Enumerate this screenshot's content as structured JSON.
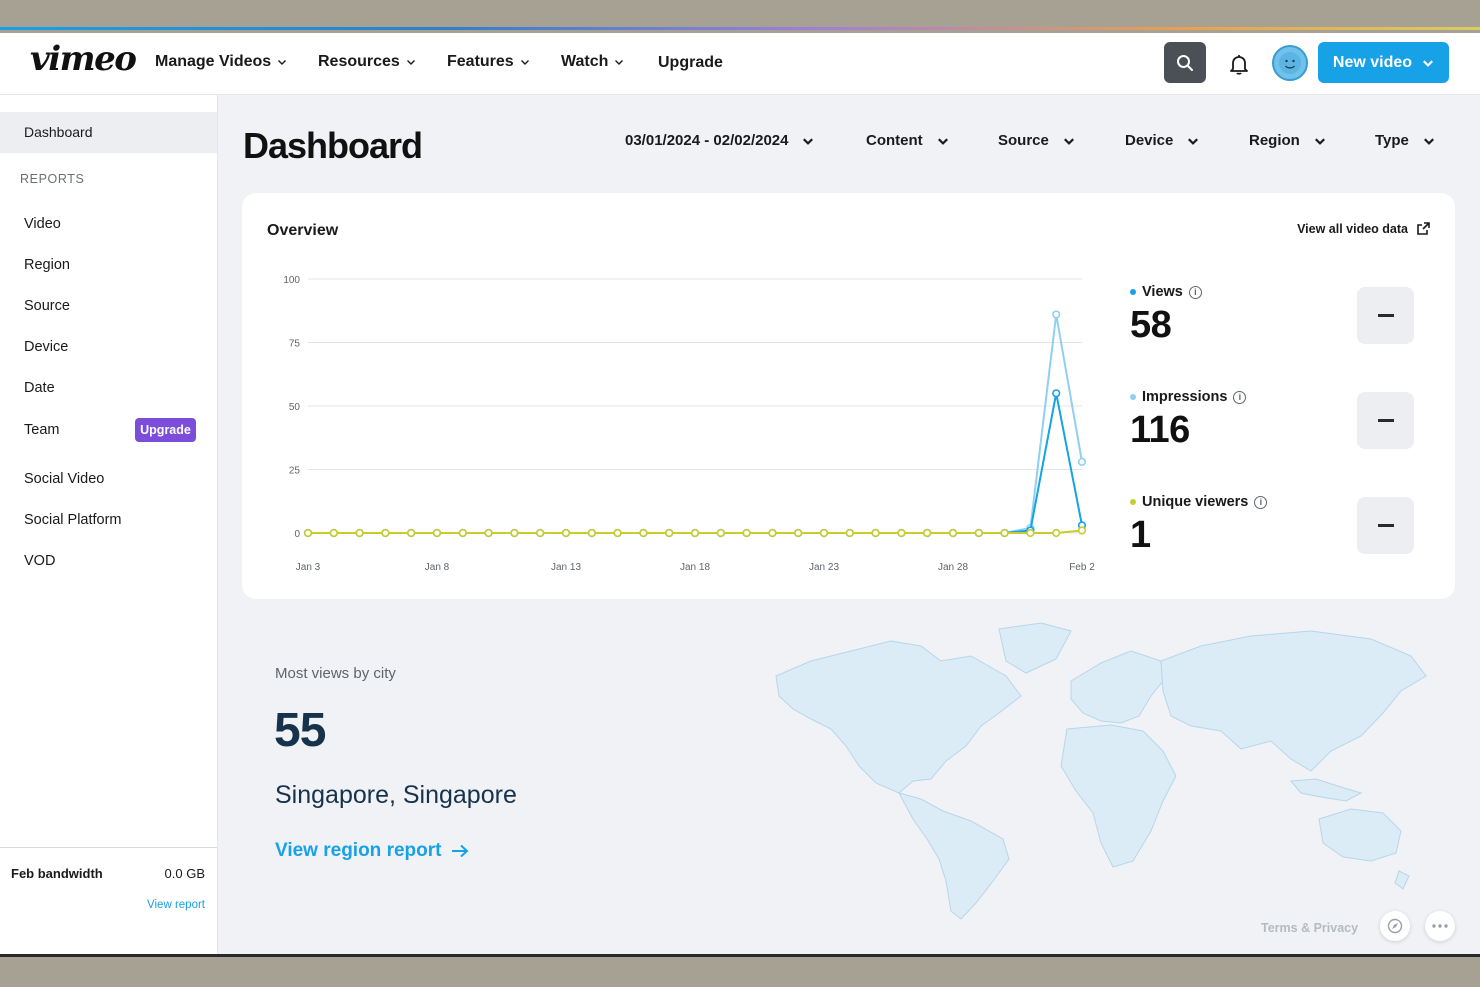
{
  "nav": {
    "logo": "vimeo",
    "items": [
      {
        "label": "Manage Videos",
        "dropdown": true
      },
      {
        "label": "Resources",
        "dropdown": true
      },
      {
        "label": "Features",
        "dropdown": true
      },
      {
        "label": "Watch",
        "dropdown": true
      },
      {
        "label": "Upgrade",
        "dropdown": false
      }
    ],
    "new_video_label": "New video",
    "icons": [
      "search-icon",
      "bell-icon",
      "avatar-icon"
    ]
  },
  "sidebar": {
    "active_item": "Dashboard",
    "section_heading": "REPORTS",
    "items": [
      "Video",
      "Region",
      "Source",
      "Device",
      "Date",
      "Team",
      "Social Video",
      "Social Platform",
      "VOD"
    ],
    "team_badge": "Upgrade",
    "bandwidth_label": "Feb bandwidth",
    "bandwidth_value": "0.0 GB",
    "view_report": "View report"
  },
  "header": {
    "title": "Dashboard",
    "filters": [
      "03/01/2024 - 02/02/2024",
      "Content",
      "Source",
      "Device",
      "Region",
      "Type"
    ]
  },
  "overview": {
    "title": "Overview",
    "view_all": "View all video data",
    "metrics": [
      {
        "label": "Views",
        "value": "58",
        "color": "#17a1e6"
      },
      {
        "label": "Impressions",
        "value": "116",
        "color": "#8fd0f2"
      },
      {
        "label": "Unique viewers",
        "value": "1",
        "color": "#c8cc2f"
      }
    ]
  },
  "chart_data": {
    "type": "line",
    "x": [
      "Jan 3",
      "Jan 4",
      "Jan 5",
      "Jan 6",
      "Jan 7",
      "Jan 8",
      "Jan 9",
      "Jan 10",
      "Jan 11",
      "Jan 12",
      "Jan 13",
      "Jan 14",
      "Jan 15",
      "Jan 16",
      "Jan 17",
      "Jan 18",
      "Jan 19",
      "Jan 20",
      "Jan 21",
      "Jan 22",
      "Jan 23",
      "Jan 24",
      "Jan 25",
      "Jan 26",
      "Jan 27",
      "Jan 28",
      "Jan 29",
      "Jan 30",
      "Jan 31",
      "Feb 1",
      "Feb 2"
    ],
    "x_tick_labels": [
      "Jan 3",
      "Jan 8",
      "Jan 13",
      "Jan 18",
      "Jan 23",
      "Jan 28",
      "Feb 2"
    ],
    "y_ticks": [
      0,
      25,
      50,
      75,
      100
    ],
    "ylim": [
      0,
      100
    ],
    "grid": true,
    "series": [
      {
        "name": "Impressions",
        "color": "#8fd0f2",
        "values": [
          0,
          0,
          0,
          0,
          0,
          0,
          0,
          0,
          0,
          0,
          0,
          0,
          0,
          0,
          0,
          0,
          0,
          0,
          0,
          0,
          0,
          0,
          0,
          0,
          0,
          0,
          0,
          0,
          2,
          86,
          28
        ]
      },
      {
        "name": "Views",
        "color": "#17a1e6",
        "values": [
          0,
          0,
          0,
          0,
          0,
          0,
          0,
          0,
          0,
          0,
          0,
          0,
          0,
          0,
          0,
          0,
          0,
          0,
          0,
          0,
          0,
          0,
          0,
          0,
          0,
          0,
          0,
          0,
          1,
          55,
          3
        ]
      },
      {
        "name": "Unique viewers",
        "color": "#c8cc2f",
        "values": [
          0,
          0,
          0,
          0,
          0,
          0,
          0,
          0,
          0,
          0,
          0,
          0,
          0,
          0,
          0,
          0,
          0,
          0,
          0,
          0,
          0,
          0,
          0,
          0,
          0,
          0,
          0,
          0,
          0,
          0,
          1
        ]
      }
    ]
  },
  "city": {
    "label": "Most views by city",
    "value": "55",
    "name": "Singapore, Singapore",
    "link": "View region report"
  },
  "footer": {
    "terms": "Terms & Privacy"
  }
}
